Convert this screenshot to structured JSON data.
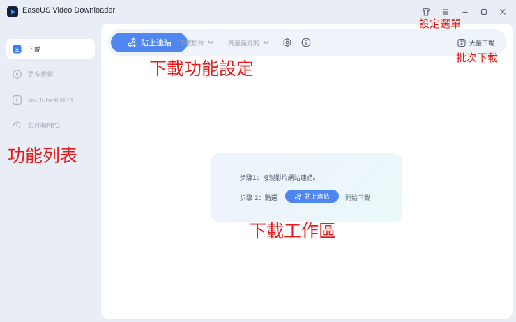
{
  "window": {
    "title": "EaseUS Video Downloader",
    "controls": [
      "tshirt-icon",
      "menu-icon",
      "minimize-icon",
      "maximize-icon",
      "close-icon"
    ]
  },
  "sidebar": {
    "items": [
      {
        "label": "下載",
        "icon": "download-icon",
        "active": true
      },
      {
        "label": "更多視頻",
        "icon": "play-circle-icon",
        "active": false
      },
      {
        "label": "YouTube到MP3",
        "icon": "play-square-icon",
        "active": false
      },
      {
        "label": "影片轉MP3",
        "icon": "convert-icon",
        "active": false
      }
    ]
  },
  "toolbar": {
    "paste_label": "貼上連結",
    "type_select": "下載影片",
    "quality_select": "質量最好的",
    "batch_label": "大量下載"
  },
  "workarea": {
    "step1": "步驟1：複製影片網站連結。",
    "step2_prefix": "步驟 2：點選",
    "paste_label": "貼上連結",
    "step2_suffix": "開始下載"
  },
  "annotations": {
    "settings_menu": "設定選單",
    "batch_download": "批次下載",
    "download_settings": "下載功能設定",
    "feature_list": "功能列表",
    "work_area": "下載工作區"
  },
  "colors": {
    "accent": "#4f86f0",
    "annotation": "#e81a1a",
    "background": "#e9eef6"
  }
}
